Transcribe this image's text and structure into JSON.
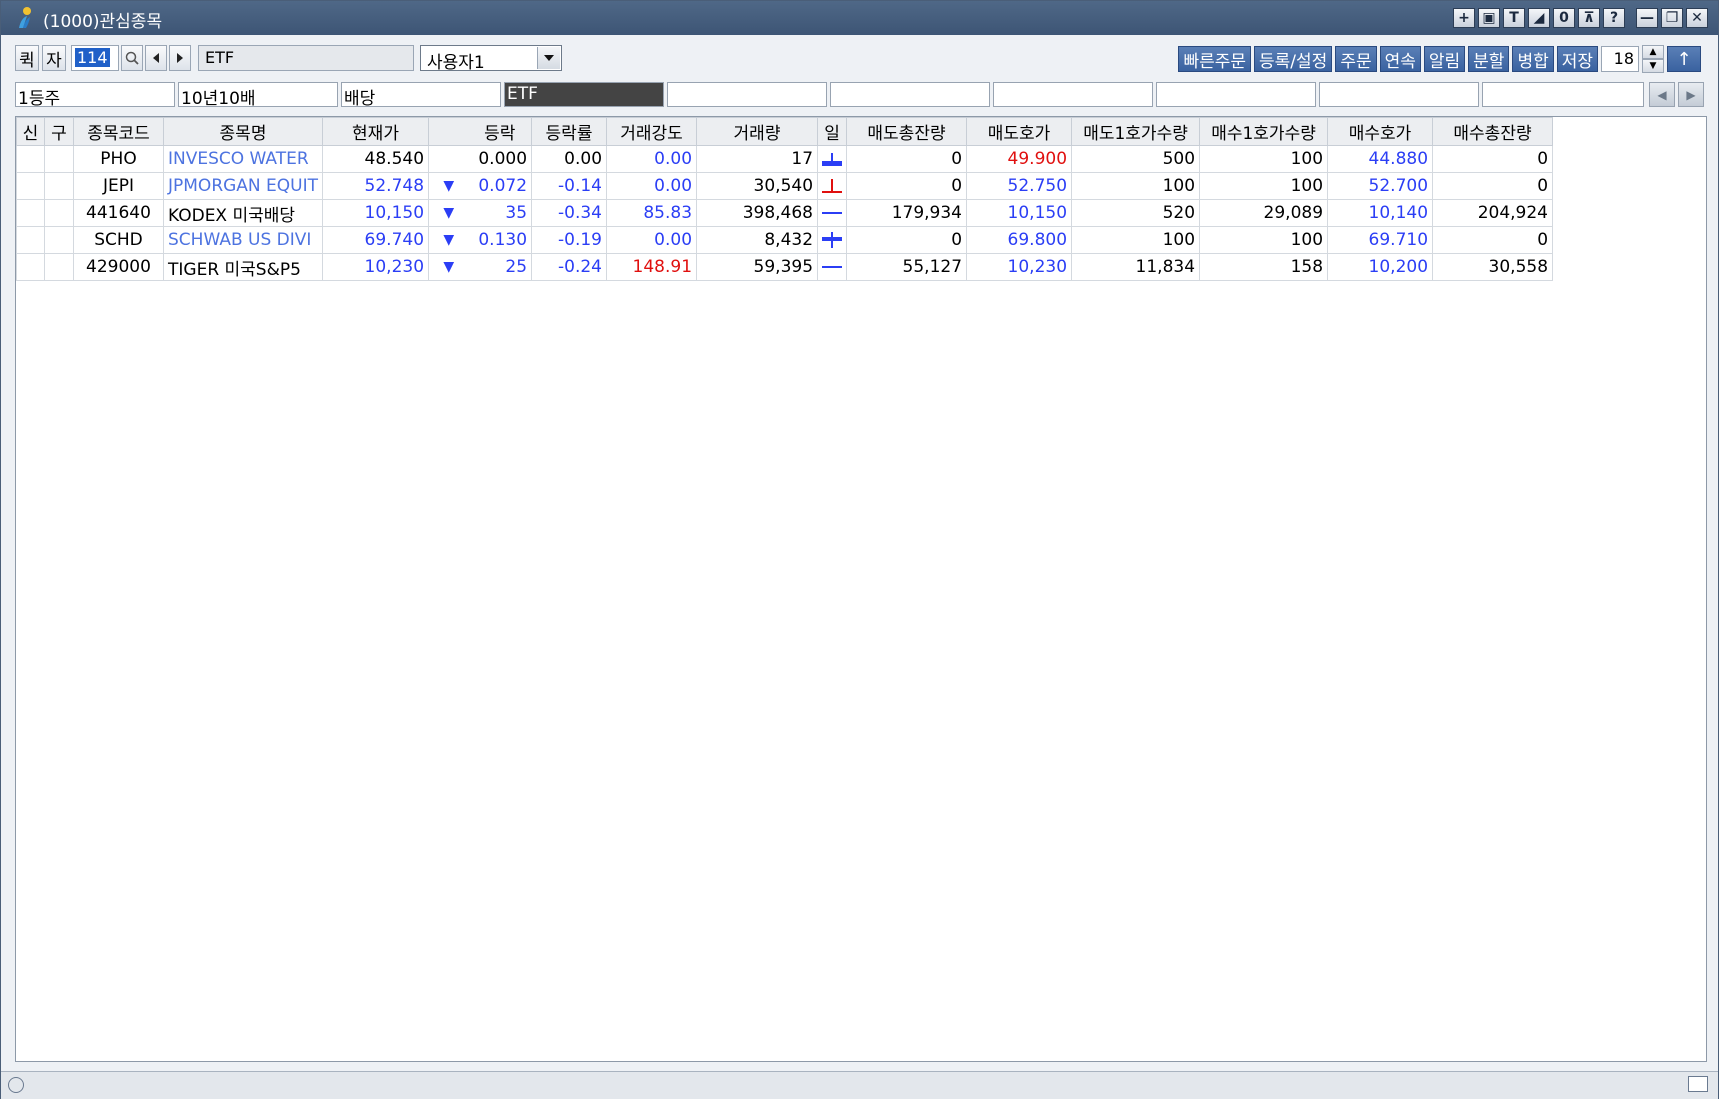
{
  "window": {
    "title": "(1000)관심종목"
  },
  "titlebar_buttons": [
    "+",
    "▣",
    "T",
    "◢",
    "0",
    "⊼",
    "?",
    "—",
    "❐",
    "✕"
  ],
  "toolbar": {
    "quick_label": "퀵",
    "ja_label": "자",
    "code_value": "114",
    "name_value": "ETF",
    "group_select": "사용자1",
    "buttons": [
      "빠른주문",
      "등록/설정",
      "주문",
      "연속",
      "알림",
      "분할",
      "병합",
      "저장"
    ],
    "count_value": "18",
    "up_label": "↑"
  },
  "groups": [
    "1등주",
    "10년10배",
    "배당",
    "ETF",
    "",
    "",
    "",
    "",
    "",
    ""
  ],
  "active_group_index": 3,
  "table": {
    "headers": [
      "신",
      "구",
      "종목코드",
      "종목명",
      "현재가",
      "",
      "등락",
      "등락률",
      "거래강도",
      "거래량",
      "일",
      "매도총잔량",
      "매도호가",
      "매도1호가수량",
      "매수1호가수량",
      "매수호가",
      "매수총잔량"
    ],
    "rows": [
      {
        "code": "PHO",
        "name": "INVESCO WATER",
        "price": "48.540",
        "dir": "",
        "change": "0.000",
        "rate": "0.00",
        "strength": "0.00",
        "volume": "17",
        "candle": "blue-t",
        "ask_total": "0",
        "ask": "49.900",
        "ask1_qty": "500",
        "bid1_qty": "100",
        "bid": "44.880",
        "bid_total": "0",
        "colors": {
          "name": "lblue",
          "price": "",
          "change": "",
          "rate": "",
          "strength": "blue",
          "ask": "red",
          "bid": "blue"
        }
      },
      {
        "code": "JEPI",
        "name": "JPMORGAN EQUIT",
        "price": "52.748",
        "dir": "▼",
        "change": "0.072",
        "rate": "-0.14",
        "strength": "0.00",
        "volume": "30,540",
        "candle": "red-inv-t",
        "ask_total": "0",
        "ask": "52.750",
        "ask1_qty": "100",
        "bid1_qty": "100",
        "bid": "52.700",
        "bid_total": "0",
        "colors": {
          "name": "lblue",
          "price": "blue",
          "change": "blue",
          "rate": "blue",
          "strength": "blue",
          "ask": "blue",
          "bid": "blue"
        }
      },
      {
        "code": "441640",
        "name": "KODEX 미국배당",
        "price": "10,150",
        "dir": "▼",
        "change": "35",
        "rate": "-0.34",
        "strength": "85.83",
        "volume": "398,468",
        "candle": "blue-line",
        "ask_total": "179,934",
        "ask": "10,150",
        "ask1_qty": "520",
        "bid1_qty": "29,089",
        "bid": "10,140",
        "bid_total": "204,924",
        "colors": {
          "name": "",
          "price": "blue",
          "change": "blue",
          "rate": "blue",
          "strength": "blue",
          "ask": "blue",
          "bid": "blue"
        }
      },
      {
        "code": "SCHD",
        "name": "SCHWAB US DIVI",
        "price": "69.740",
        "dir": "▼",
        "change": "0.130",
        "rate": "-0.19",
        "strength": "0.00",
        "volume": "8,432",
        "candle": "blue-cross",
        "ask_total": "0",
        "ask": "69.800",
        "ask1_qty": "100",
        "bid1_qty": "100",
        "bid": "69.710",
        "bid_total": "0",
        "colors": {
          "name": "lblue",
          "price": "blue",
          "change": "blue",
          "rate": "blue",
          "strength": "blue",
          "ask": "blue",
          "bid": "blue"
        }
      },
      {
        "code": "429000",
        "name": "TIGER 미국S&P5",
        "price": "10,230",
        "dir": "▼",
        "change": "25",
        "rate": "-0.24",
        "strength": "148.91",
        "volume": "59,395",
        "candle": "blue-line",
        "ask_total": "55,127",
        "ask": "10,230",
        "ask1_qty": "11,834",
        "bid1_qty": "158",
        "bid": "10,200",
        "bid_total": "30,558",
        "colors": {
          "name": "",
          "price": "blue",
          "change": "blue",
          "rate": "blue",
          "strength": "red",
          "ask": "blue",
          "bid": "blue"
        }
      }
    ]
  },
  "colors": {
    "blue": "#2b3ef5",
    "red": "#e0100f",
    "lblue": "#4d73e0",
    "titlebar": "#45607f",
    "action_button": "#4a70ab"
  }
}
